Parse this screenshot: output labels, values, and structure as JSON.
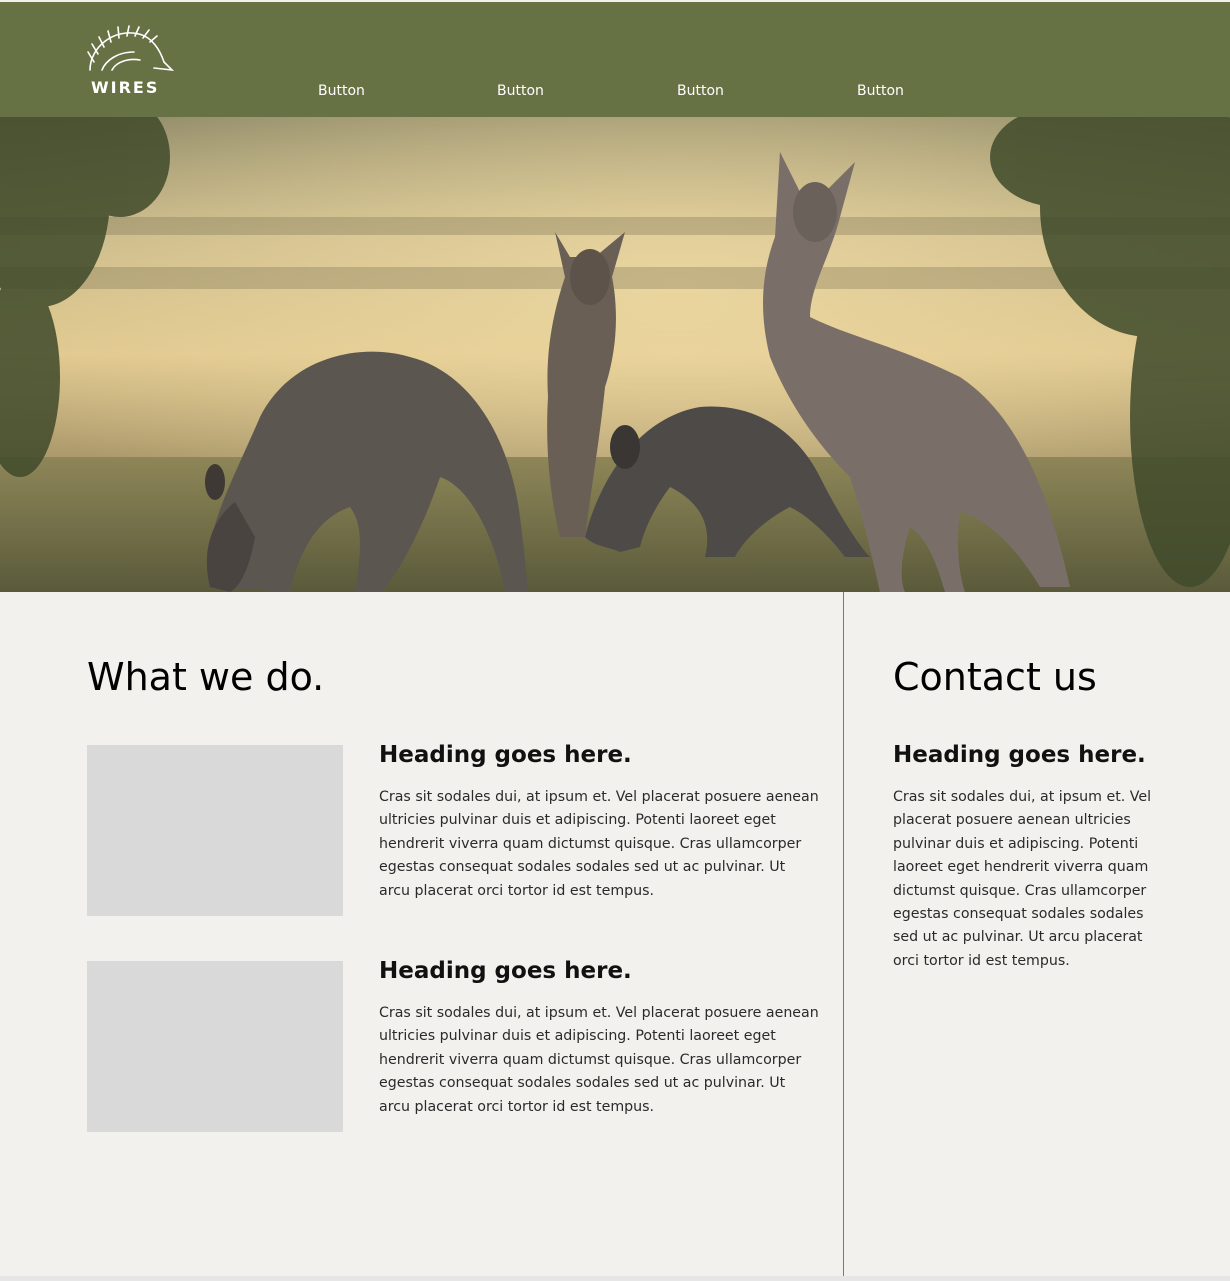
{
  "colors": {
    "header_bg": "#667144",
    "content_bg": "#f2f1ee",
    "placeholder": "#d9d9d9"
  },
  "header": {
    "logo_text": "WIRES",
    "logo_icon": "echidna-icon",
    "nav": [
      {
        "label": "Button"
      },
      {
        "label": "Button"
      },
      {
        "label": "Button"
      },
      {
        "label": "Button"
      }
    ]
  },
  "hero": {
    "image": "kangaroos-grazing-photo"
  },
  "what_we_do": {
    "title": "What we do.",
    "cards": [
      {
        "heading": "Heading goes here.",
        "text": "Cras sit sodales dui, at ipsum et. Vel placerat posuere aenean ultricies pulvinar duis et adipiscing. Potenti laoreet eget hendrerit viverra quam dictumst quisque. Cras ullamcorper egestas consequat sodales sodales sed ut ac pulvinar. Ut arcu placerat orci tortor id est tempus."
      },
      {
        "heading": "Heading goes here.",
        "text": "Cras sit sodales dui, at ipsum et. Vel placerat posuere aenean ultricies pulvinar duis et adipiscing. Potenti laoreet eget hendrerit viverra quam dictumst quisque. Cras ullamcorper egestas consequat sodales sodales sed ut ac pulvinar. Ut arcu placerat orci tortor id est tempus."
      }
    ]
  },
  "contact": {
    "title": "Contact us",
    "heading": "Heading goes here.",
    "text": "Cras sit sodales dui, at ipsum et. Vel placerat posuere aenean ultricies pulvinar duis et adipiscing. Potenti laoreet eget hendrerit viverra quam dictumst quisque. Cras ullamcorper egestas consequat sodales sodales sed ut ac pulvinar. Ut arcu placerat orci tortor id est tempus."
  }
}
